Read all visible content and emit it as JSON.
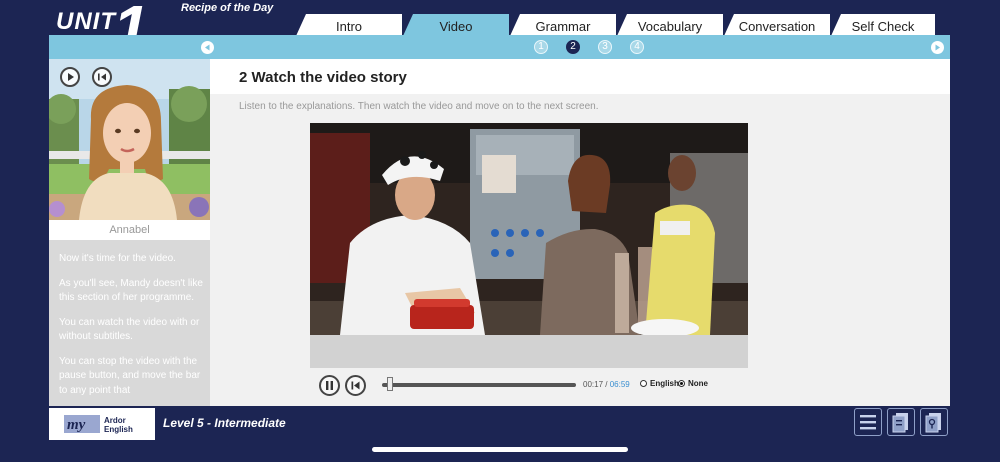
{
  "header": {
    "unit_word": "UNIT",
    "unit_number": "1",
    "lesson_title": "Recipe of the Day"
  },
  "tabs": [
    {
      "label": "Intro",
      "active": false
    },
    {
      "label": "Video",
      "active": true
    },
    {
      "label": "Grammar",
      "active": false
    },
    {
      "label": "Vocabulary",
      "active": false
    },
    {
      "label": "Conversation",
      "active": false
    },
    {
      "label": "Self Check",
      "active": false
    }
  ],
  "steps": {
    "items": [
      "1",
      "2",
      "3",
      "4"
    ],
    "current": "2"
  },
  "presenter": {
    "name": "Annabel",
    "narration": [
      "Now it's time for the video.",
      "As you'll see, Mandy doesn't like this section of her programme.",
      "You can watch the video with or without subtitles.",
      "You can stop the video with the pause button, and move the bar to any point that"
    ]
  },
  "content": {
    "step_title": "2 Watch the video story",
    "instructions": "Listen to the explanations. Then watch the video and move on to the next screen."
  },
  "video": {
    "current_time": "00:17",
    "separator": "/",
    "total_time": "06:59",
    "progress": 0.04,
    "subtitle_options": [
      {
        "label": "English",
        "selected": false
      },
      {
        "label": "None",
        "selected": true
      }
    ]
  },
  "footer": {
    "logo_text_1": "Ardor",
    "logo_text_2": "English",
    "logo_mark": "my",
    "level_label": "Level 5 - Intermediate"
  },
  "colors": {
    "background": "#1c2553",
    "accent": "#7ec6df",
    "panel_grey": "#d9d9d9"
  }
}
